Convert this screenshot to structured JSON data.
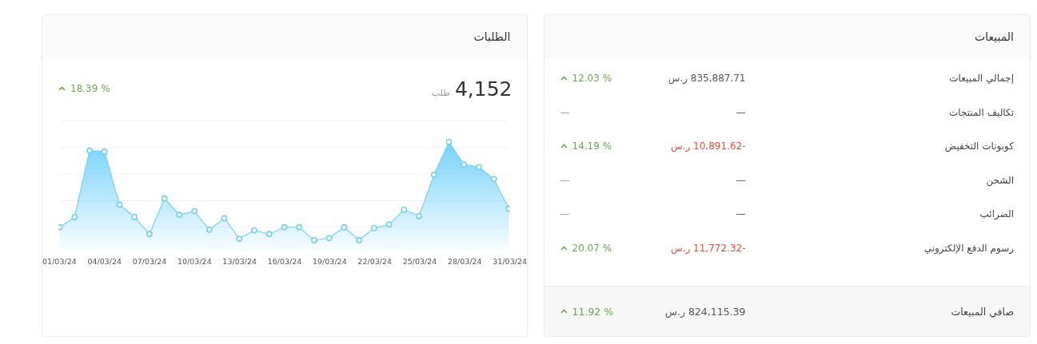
{
  "orders": {
    "title": "الطلبات",
    "total": "4,152",
    "unit": "طلب",
    "change": {
      "text": "18.39 %",
      "rising": true
    },
    "x_labels": [
      "31/03/24",
      "28/03/24",
      "25/03/24",
      "22/03/24",
      "19/03/24",
      "16/03/24",
      "13/03/24",
      "10/03/24",
      "07/03/24",
      "04/03/24",
      "01/03/24"
    ]
  },
  "sales": {
    "title": "المبيعات",
    "rows": [
      {
        "label": "إجمالي المبيعات",
        "amount": "835,887.71 ر.س",
        "negative": false,
        "change": {
          "text": "12.03 %",
          "rising": true
        }
      },
      {
        "label": "تكاليف المنتجات",
        "amount": "—",
        "negative": false,
        "change": {
          "text": "—",
          "rising": false
        }
      },
      {
        "label": "كوبونات التخفيض",
        "amount": "-10,891.62 ر.س",
        "negative": true,
        "change": {
          "text": "14.19 %",
          "rising": true
        }
      },
      {
        "label": "الشحن",
        "amount": "—",
        "negative": false,
        "change": {
          "text": "—",
          "rising": false
        }
      },
      {
        "label": "الضرائب",
        "amount": "—",
        "negative": false,
        "change": {
          "text": "—",
          "rising": false
        }
      },
      {
        "label": "رسوم الدفع الإلكتروني",
        "amount": "-11,772.32 ر.س",
        "negative": true,
        "change": {
          "text": "20.07 %",
          "rising": true
        }
      }
    ],
    "footer": {
      "label": "صافي المبيعات",
      "amount": "824,115.39 ر.س",
      "negative": false,
      "change": {
        "text": "11.92 %",
        "rising": true
      }
    }
  }
}
